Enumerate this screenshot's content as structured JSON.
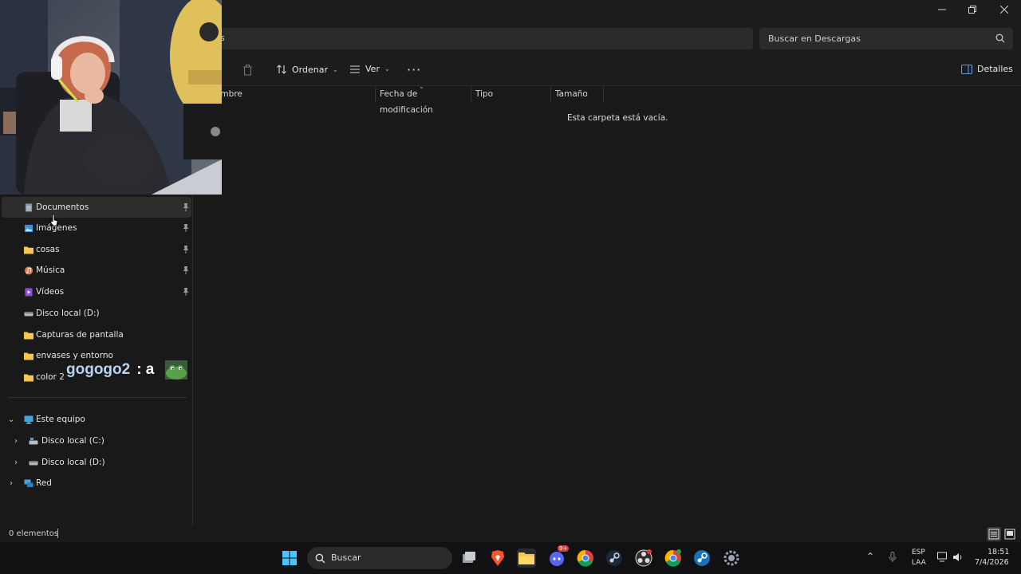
{
  "window": {
    "address_partial": "s"
  },
  "search": {
    "placeholder": "Buscar en Descargas"
  },
  "toolbar": {
    "sort_label": "Ordenar",
    "view_label": "Ver",
    "details_label": "Detalles"
  },
  "columns": {
    "name": "ombre",
    "modified": "Fecha de modificación",
    "type": "Tipo",
    "size": "Tamaño"
  },
  "content": {
    "empty_message": "Esta carpeta está vacía."
  },
  "sidebar": {
    "quick_access": [
      {
        "label": "Documentos",
        "icon": "document-icon",
        "pinned": true
      },
      {
        "label": "Imágenes",
        "icon": "pictures-icon",
        "pinned": true
      },
      {
        "label": "cosas",
        "icon": "folder-icon",
        "pinned": true
      },
      {
        "label": "Música",
        "icon": "music-icon",
        "pinned": true
      },
      {
        "label": "Vídeos",
        "icon": "video-icon",
        "pinned": true
      },
      {
        "label": "Disco local (D:)",
        "icon": "drive-icon",
        "pinned": false
      },
      {
        "label": "Capturas de pantalla",
        "icon": "folder-icon",
        "pinned": false
      },
      {
        "label": "envases y entorno",
        "icon": "folder-icon",
        "pinned": false
      },
      {
        "label": "color 2",
        "icon": "folder-icon",
        "pinned": false
      }
    ],
    "this_pc": {
      "label": "Este equipo",
      "drives": [
        {
          "label": "Disco local (C:)"
        },
        {
          "label": "Disco local (D:)"
        }
      ]
    },
    "network": {
      "label": "Red"
    }
  },
  "chat_overlay": {
    "user": "gogogo2",
    "message": ": a"
  },
  "status": {
    "item_count": "0 elementos"
  },
  "taskbar": {
    "search_label": "Buscar",
    "language_top": "ESP",
    "language_bottom": "LAA",
    "time": "18:51",
    "date": "7/4/2026",
    "discord_badge": "9+"
  },
  "colors": {
    "window_bg": "#191919",
    "chrome_bg": "#1c1c1c",
    "folder_yellow": "#f4c84a",
    "chat_user": "#b8d4f0"
  }
}
